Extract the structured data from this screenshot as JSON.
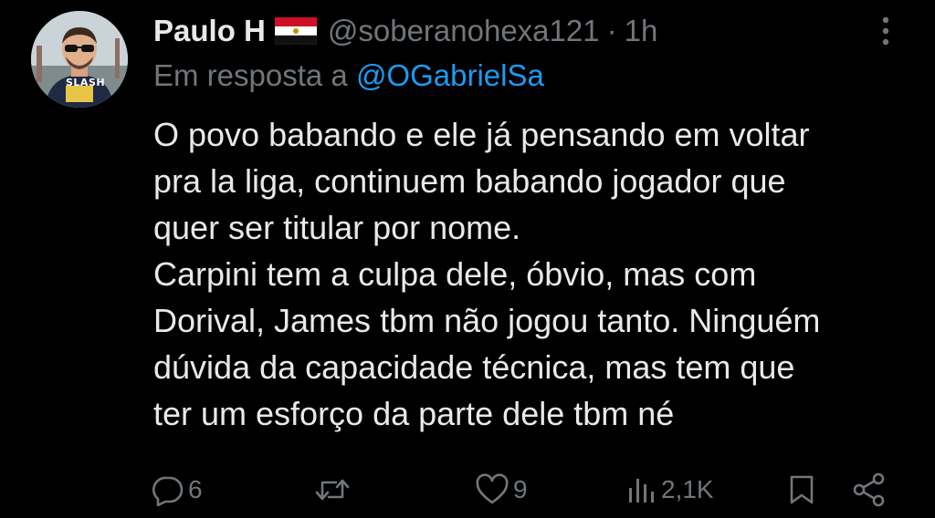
{
  "tweet": {
    "display_name": "Paulo H",
    "handle": "@soberanohexa121",
    "separator": "·",
    "time": "1h",
    "reply_prefix": "Em resposta a",
    "reply_to": "@OGabrielSa",
    "lines": [
      "O povo babando e ele já pensando em voltar",
      "pra la liga, continuem babando jogador que",
      "quer ser titular por nome.",
      "Carpini tem a culpa dele, óbvio, mas com",
      "Dorival, James tbm não jogou tanto. Ninguém",
      "dúvida da capacidade técnica, mas tem que",
      "ter um esforço da parte dele tbm né"
    ],
    "avatar_shirt_text": "SLASH",
    "flag": "egypt-flag-icon",
    "actions": {
      "replies": "6",
      "likes": "9",
      "views": "2,1K"
    }
  },
  "icons": {
    "reply": "speech-bubble-icon",
    "retweet": "retweet-icon",
    "like": "heart-icon",
    "views": "bar-chart-icon",
    "bookmark": "bookmark-icon",
    "share": "share-icon",
    "more": "vertical-dots-icon"
  },
  "colors": {
    "background": "#000000",
    "text": "#e7e9ea",
    "muted": "#71767b",
    "accent": "#1d9bf0"
  }
}
